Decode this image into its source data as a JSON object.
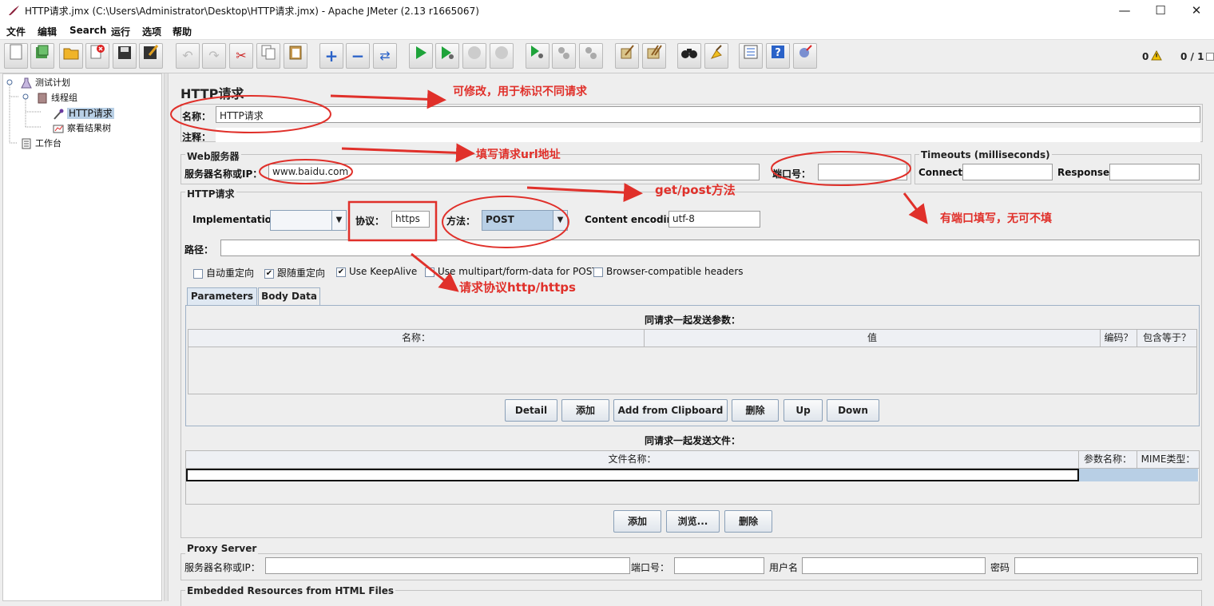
{
  "window": {
    "title": "HTTP请求.jmx (C:\\Users\\Administrator\\Desktop\\HTTP请求.jmx) - Apache JMeter (2.13 r1665067)",
    "minimize": "—",
    "maximize": "☐",
    "close": "✕"
  },
  "menu": [
    "文件",
    "编辑",
    "Search",
    "运行",
    "选项",
    "帮助"
  ],
  "toolbar": {
    "icons": [
      "new-icon",
      "templates-icon",
      "open-icon",
      "close-icon",
      "save-icon",
      "save-as-icon",
      "undo-icon",
      "redo-icon",
      "cut-icon",
      "copy-icon",
      "paste-icon",
      "expand-icon",
      "collapse-icon",
      "toggle-icon",
      "start-icon",
      "start-no-pause-icon",
      "stop-icon",
      "shutdown-icon",
      "remote-start-icon",
      "remote-stop-icon",
      "remote-shutdown-icon",
      "clear-icon",
      "clear-all-icon",
      "search-icon",
      "reset-search-icon",
      "function-helper-icon",
      "help-icon",
      "log-icon"
    ],
    "error_count": "0",
    "thread_count": "0 / 1"
  },
  "tree": {
    "items": [
      {
        "label": "测试计划",
        "icon": "test-plan-icon"
      },
      {
        "label": "线程组",
        "icon": "thread-group-icon"
      },
      {
        "label": "HTTP请求",
        "icon": "http-sampler-icon"
      },
      {
        "label": "察看结果树",
        "icon": "results-tree-icon"
      },
      {
        "label": "工作台",
        "icon": "workbench-icon"
      }
    ]
  },
  "panel": {
    "title": "HTTP请求",
    "name_label": "名称：",
    "name_value": "HTTP请求",
    "comment_label": "注释：",
    "web_server": {
      "title": "Web服务器",
      "server_label": "服务器名称或IP：",
      "server_value": "www.baidu.com",
      "port_label": "端口号：",
      "port_value": ""
    },
    "timeouts": {
      "title": "Timeouts (milliseconds)",
      "connect_label": "Connect:",
      "connect_value": "",
      "response_label": "Response:",
      "response_value": ""
    },
    "http_request": {
      "title": "HTTP请求",
      "implementation_label": "Implementation:",
      "implementation_value": "",
      "protocol_label": "协议：",
      "protocol_value": "https",
      "method_label": "方法：",
      "method_value": "POST",
      "encoding_label": "Content encoding:",
      "encoding_value": "utf-8",
      "path_label": "路径：",
      "path_value": ""
    },
    "options": [
      {
        "label": "自动重定向",
        "checked": false
      },
      {
        "label": "跟随重定向",
        "checked": true
      },
      {
        "label": "Use KeepAlive",
        "checked": true
      },
      {
        "label": "Use multipart/form-data for POST",
        "checked": false
      },
      {
        "label": "Browser-compatible headers",
        "checked": false
      }
    ],
    "tabs": [
      "Parameters",
      "Body Data"
    ],
    "params": {
      "caption": "同请求一起发送参数：",
      "columns": [
        "名称：",
        "值",
        "编码？",
        "包含等于？"
      ],
      "buttons": [
        "Detail",
        "添加",
        "Add from Clipboard",
        "删除",
        "Up",
        "Down"
      ]
    },
    "files": {
      "caption": "同请求一起发送文件：",
      "columns": [
        "文件名称：",
        "参数名称：",
        "MIME类型："
      ],
      "buttons": [
        "添加",
        "浏览...",
        "删除"
      ]
    },
    "proxy": {
      "title": "Proxy Server",
      "server_label": "服务器名称或IP：",
      "port_label": "端口号：",
      "user_label": "用户名",
      "password_label": "密码"
    },
    "embedded": {
      "title": "Embedded Resources from HTML Files"
    }
  },
  "annotations": {
    "name_note": "可修改，用于标识不同请求",
    "url_note": "填写请求url地址",
    "method_note": "get/post方法",
    "port_note": "有端口填写，无可不填",
    "protocol_note": "请求协议http/https"
  },
  "colors": {
    "annotation": "#e0302a",
    "selection": "#b8cfe5",
    "method_bg": "#b8cfe5"
  }
}
